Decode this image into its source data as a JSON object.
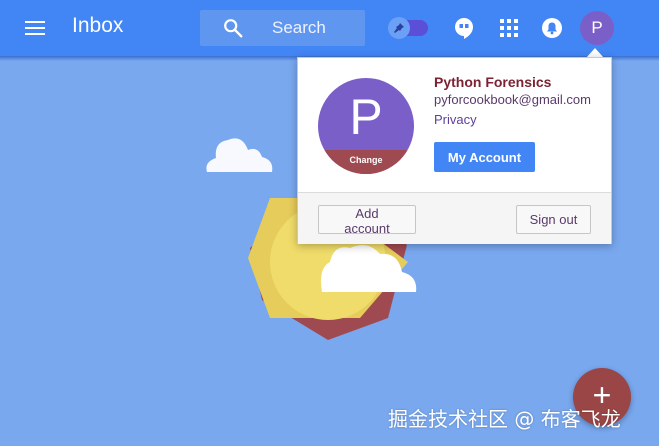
{
  "header": {
    "title": "Inbox",
    "search_placeholder": "Search",
    "avatar_letter": "P",
    "icons": {
      "menu": "hamburger-menu-icon",
      "search": "search-icon",
      "pin": "pin-icon",
      "hangouts": "hangouts-icon",
      "apps": "apps-grid-icon",
      "notifications": "bell-icon"
    }
  },
  "account_popup": {
    "avatar_letter": "P",
    "change_label": "Change",
    "name": "Python Forensics",
    "email": "pyforcookbook@gmail.com",
    "privacy_label": "Privacy",
    "my_account_label": "My Account",
    "add_account_label": "Add account",
    "sign_out_label": "Sign out"
  },
  "fab": {
    "label": "+"
  },
  "watermark": "掘金技术社区 @ 布客飞龙",
  "colors": {
    "header": "#4285f4",
    "background": "#79a8ef",
    "avatar": "#7b5fc9",
    "primary_button": "#4285f4",
    "fab": "#9a4646"
  }
}
